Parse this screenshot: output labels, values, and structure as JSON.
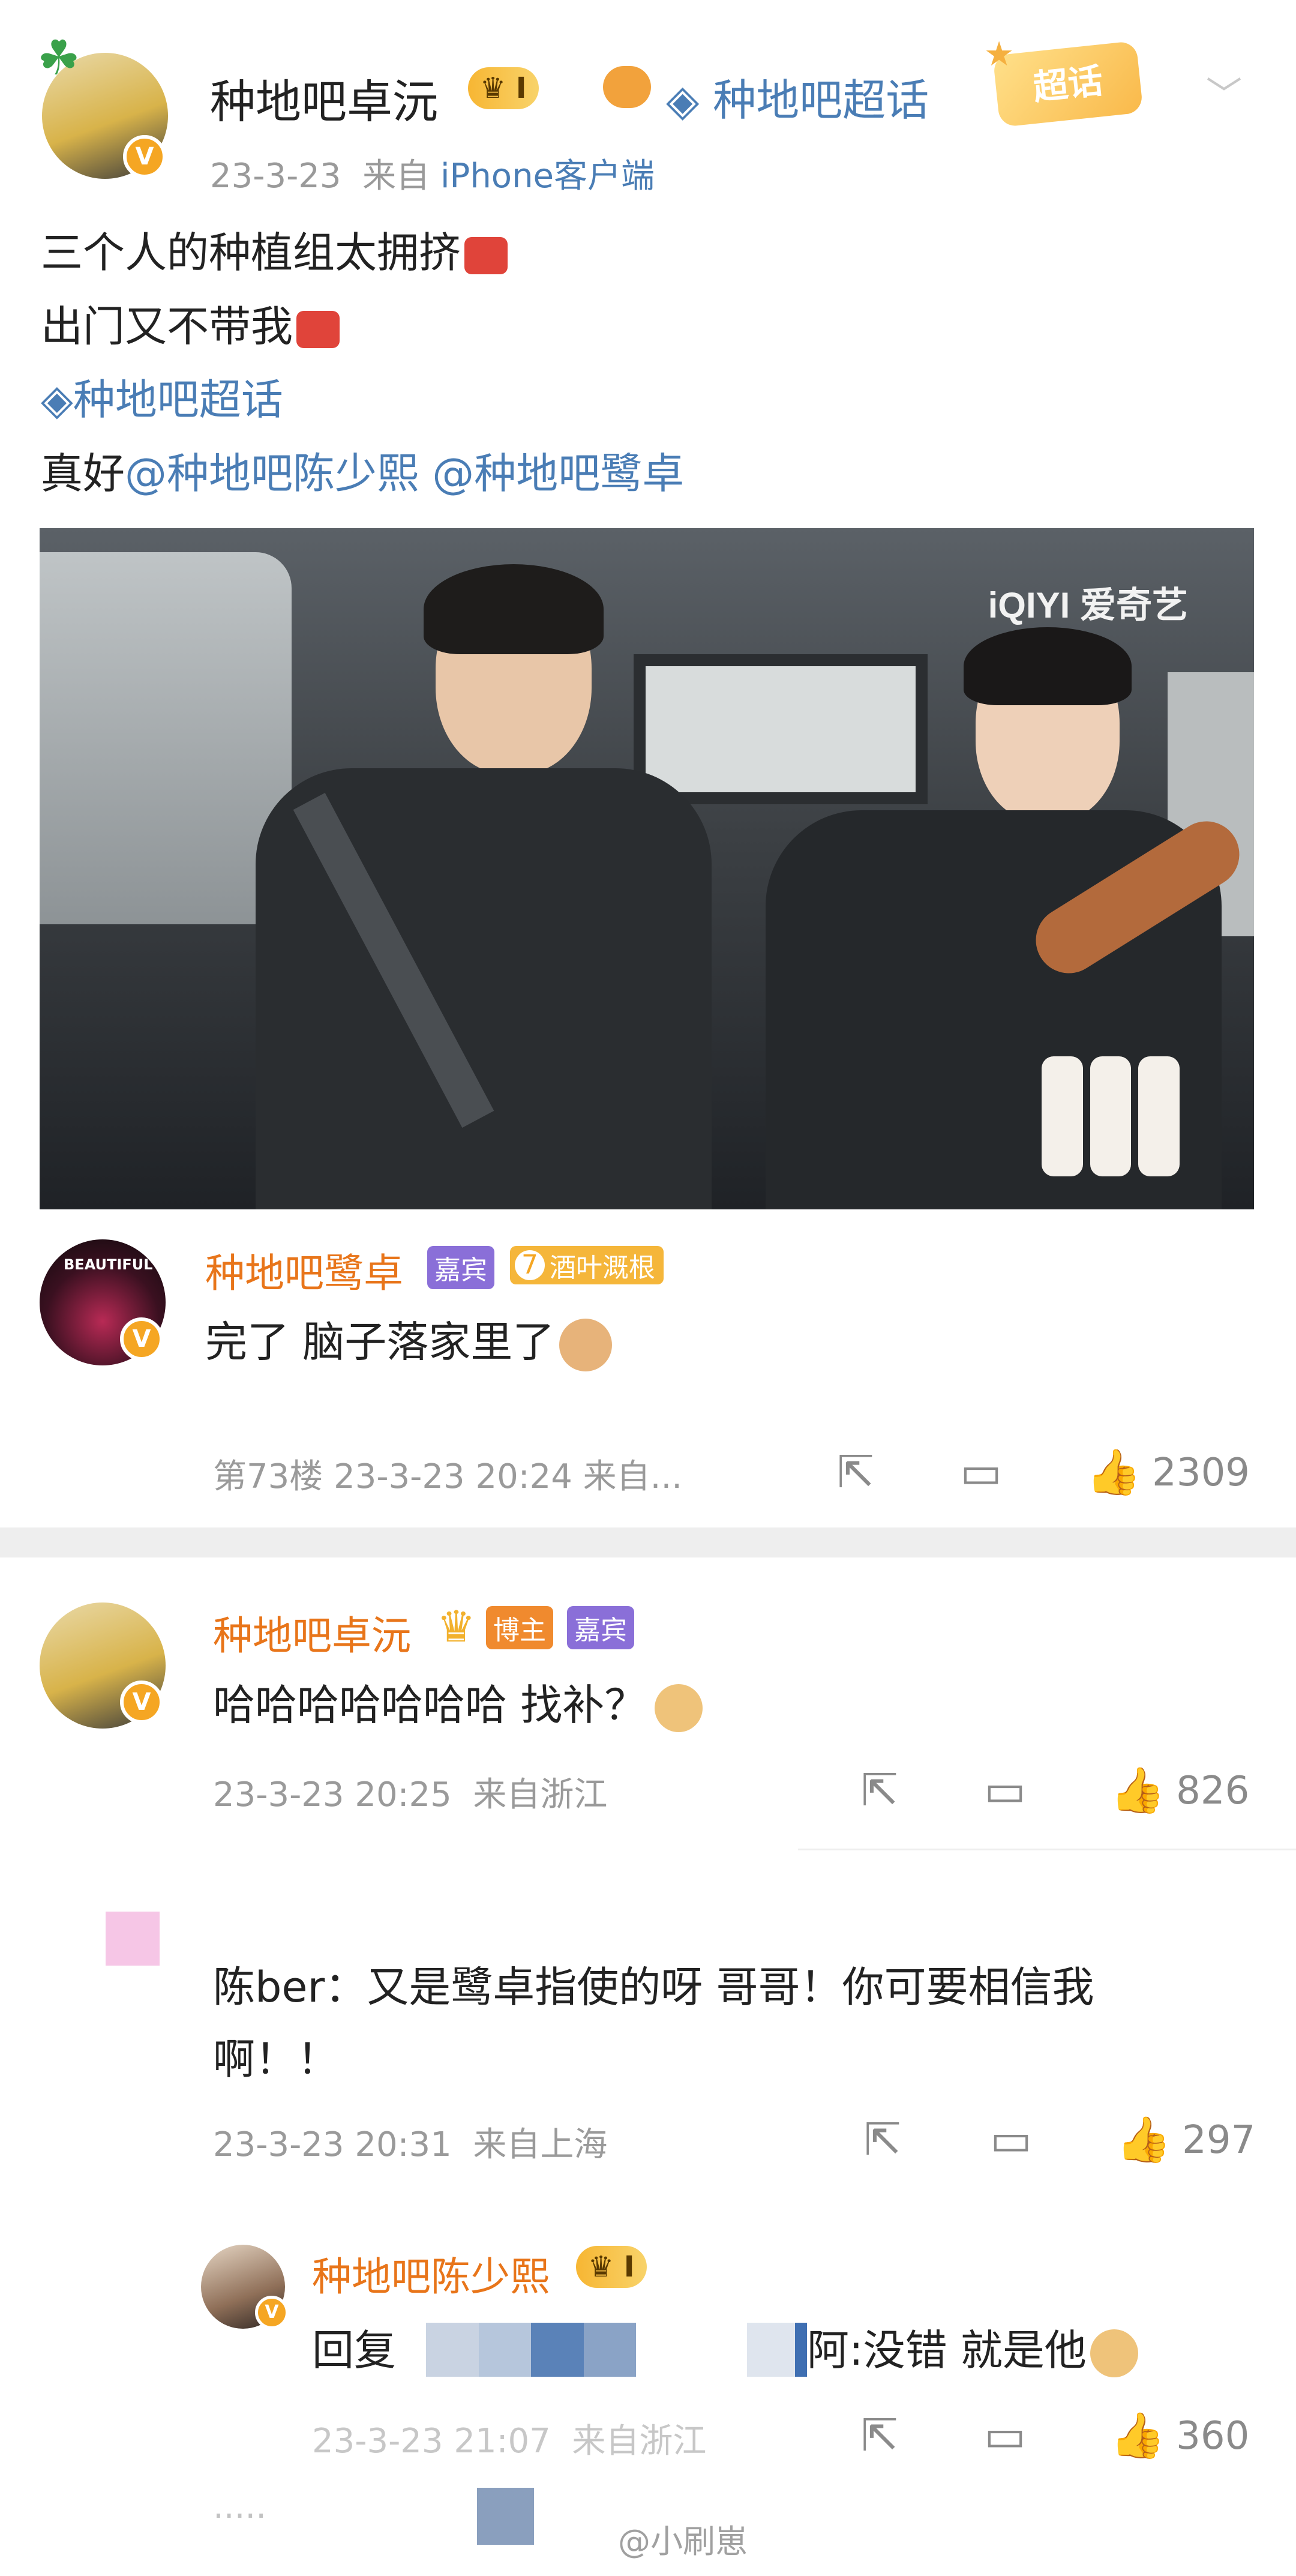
{
  "post": {
    "author": "种地吧卓沅",
    "level": "I",
    "topic_tag": "种地吧超话",
    "topic_badge": "超话",
    "date": "23-3-23",
    "source_prefix": "来自",
    "source": "iPhone客户端",
    "lines": [
      "三个人的种植组太拥挤",
      "出门又不带我"
    ],
    "topic_link": "种地吧超话",
    "text_prefix": "真好",
    "mention1": "@种地吧陈少熙",
    "mention2": "@种地吧鹭卓",
    "video_watermark": "iQIYI 爱奇艺"
  },
  "quoted_comment": {
    "author": "种地吧鹭卓",
    "badge_guest": "嘉宾",
    "badge_fan_level": "7",
    "badge_fan": "酒叶溉根",
    "text": "完了 脑子落家里了",
    "floor": "第73楼",
    "time": "23-3-23 20:24",
    "source": "来自...",
    "likes": "2309"
  },
  "comments": [
    {
      "author": "种地吧卓沅",
      "badge_blogger": "博主",
      "badge_guest": "嘉宾",
      "text": "哈哈哈哈哈哈哈 找补？",
      "time": "23-3-23 20:25",
      "source": "来自浙江",
      "likes": "826"
    },
    {
      "author": "",
      "text_line1": "陈ber：又是鹭卓指使的呀 哥哥！你可要相信我",
      "text_line2": "啊！！",
      "time": "23-3-23 20:31",
      "source": "来自上海",
      "likes": "297"
    }
  ],
  "reply": {
    "author": "种地吧陈少熙",
    "level": "I",
    "prefix": "回复",
    "suffix": "阿:没错 就是他",
    "time": "23-3-23 21:07",
    "source": "来自浙江",
    "likes": "360"
  },
  "footer": {
    "more": "·····",
    "watermark": "@小刷崽"
  },
  "colors": {
    "name_orange": "#e8751a",
    "link_blue": "#4a7db5",
    "meta_gray": "#9a9a9a",
    "gold": "#f5a623",
    "guest_purple": "#8a6fd8"
  }
}
